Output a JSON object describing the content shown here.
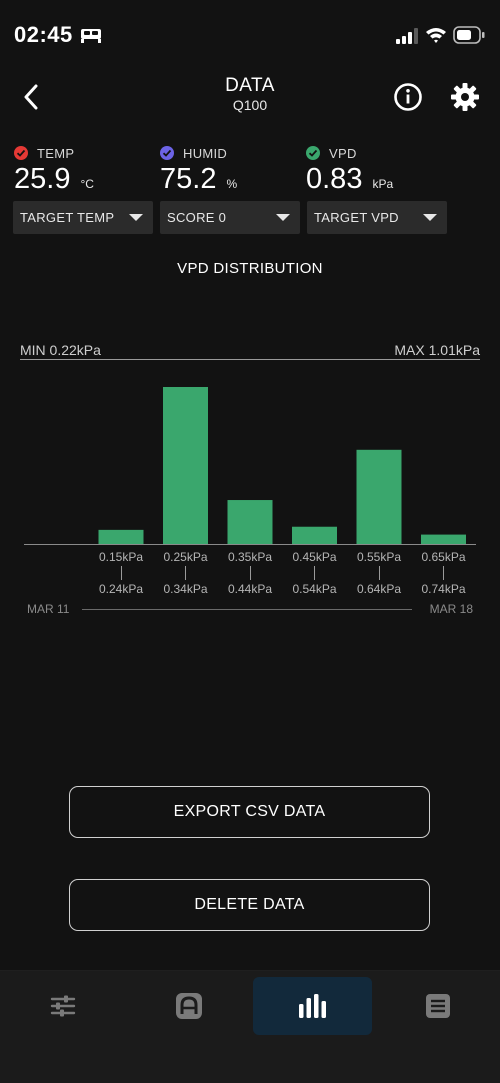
{
  "status_bar": {
    "time": "02:45"
  },
  "header": {
    "title": "DATA",
    "subtitle": "Q100"
  },
  "readings": [
    {
      "label": "TEMP",
      "value": "25.9",
      "unit": "°C",
      "color": "#e53935",
      "checked": true
    },
    {
      "label": "HUMID",
      "value": "75.2",
      "unit": "%",
      "color": "#6c63e6",
      "checked": true
    },
    {
      "label": "VPD",
      "value": "0.83",
      "unit": "kPa",
      "color": "#3aa76d",
      "checked": true
    }
  ],
  "dropdowns": [
    {
      "label": "TARGET TEMP"
    },
    {
      "label": "SCORE 0"
    },
    {
      "label": "TARGET VPD"
    }
  ],
  "chart_data": {
    "type": "bar",
    "title": "VPD DISTRIBUTION",
    "min_label": "MIN 0.22kPa",
    "max_label": "MAX 1.01kPa",
    "categories": [
      {
        "from": "0.15kPa",
        "to": "0.24kPa"
      },
      {
        "from": "0.25kPa",
        "to": "0.34kPa"
      },
      {
        "from": "0.35kPa",
        "to": "0.44kPa"
      },
      {
        "from": "0.45kPa",
        "to": "0.54kPa"
      },
      {
        "from": "0.55kPa",
        "to": "0.64kPa"
      },
      {
        "from": "0.65kPa",
        "to": "0.74kPa"
      }
    ],
    "values": [
      9,
      100,
      28,
      11,
      60,
      6
    ],
    "ylim": [
      0,
      100
    ],
    "bar_color": "#3aa76d",
    "date_start": "MAR 11",
    "date_end": "MAR 18"
  },
  "actions": {
    "export_label": "EXPORT CSV DATA",
    "delete_label": "DELETE DATA"
  },
  "tabs": [
    {
      "icon": "sliders-icon",
      "active": false
    },
    {
      "icon": "app-a-icon",
      "active": false
    },
    {
      "icon": "bar-chart-icon",
      "active": true
    },
    {
      "icon": "list-icon",
      "active": false
    }
  ],
  "colors": {
    "background": "#121212",
    "accent_tab": "#12293b",
    "bar": "#3aa76d"
  }
}
